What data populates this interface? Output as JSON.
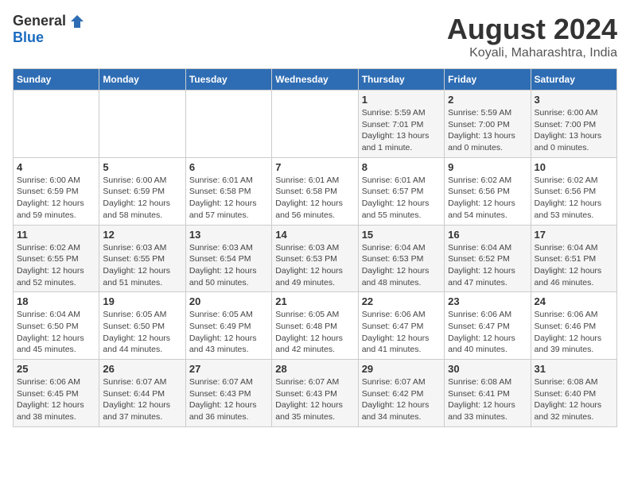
{
  "header": {
    "logo_general": "General",
    "logo_blue": "Blue",
    "title": "August 2024",
    "subtitle": "Koyali, Maharashtra, India"
  },
  "days_of_week": [
    "Sunday",
    "Monday",
    "Tuesday",
    "Wednesday",
    "Thursday",
    "Friday",
    "Saturday"
  ],
  "weeks": [
    [
      {
        "day": "",
        "info": ""
      },
      {
        "day": "",
        "info": ""
      },
      {
        "day": "",
        "info": ""
      },
      {
        "day": "",
        "info": ""
      },
      {
        "day": "1",
        "info": "Sunrise: 5:59 AM\nSunset: 7:01 PM\nDaylight: 13 hours\nand 1 minute."
      },
      {
        "day": "2",
        "info": "Sunrise: 5:59 AM\nSunset: 7:00 PM\nDaylight: 13 hours\nand 0 minutes."
      },
      {
        "day": "3",
        "info": "Sunrise: 6:00 AM\nSunset: 7:00 PM\nDaylight: 13 hours\nand 0 minutes."
      }
    ],
    [
      {
        "day": "4",
        "info": "Sunrise: 6:00 AM\nSunset: 6:59 PM\nDaylight: 12 hours\nand 59 minutes."
      },
      {
        "day": "5",
        "info": "Sunrise: 6:00 AM\nSunset: 6:59 PM\nDaylight: 12 hours\nand 58 minutes."
      },
      {
        "day": "6",
        "info": "Sunrise: 6:01 AM\nSunset: 6:58 PM\nDaylight: 12 hours\nand 57 minutes."
      },
      {
        "day": "7",
        "info": "Sunrise: 6:01 AM\nSunset: 6:58 PM\nDaylight: 12 hours\nand 56 minutes."
      },
      {
        "day": "8",
        "info": "Sunrise: 6:01 AM\nSunset: 6:57 PM\nDaylight: 12 hours\nand 55 minutes."
      },
      {
        "day": "9",
        "info": "Sunrise: 6:02 AM\nSunset: 6:56 PM\nDaylight: 12 hours\nand 54 minutes."
      },
      {
        "day": "10",
        "info": "Sunrise: 6:02 AM\nSunset: 6:56 PM\nDaylight: 12 hours\nand 53 minutes."
      }
    ],
    [
      {
        "day": "11",
        "info": "Sunrise: 6:02 AM\nSunset: 6:55 PM\nDaylight: 12 hours\nand 52 minutes."
      },
      {
        "day": "12",
        "info": "Sunrise: 6:03 AM\nSunset: 6:55 PM\nDaylight: 12 hours\nand 51 minutes."
      },
      {
        "day": "13",
        "info": "Sunrise: 6:03 AM\nSunset: 6:54 PM\nDaylight: 12 hours\nand 50 minutes."
      },
      {
        "day": "14",
        "info": "Sunrise: 6:03 AM\nSunset: 6:53 PM\nDaylight: 12 hours\nand 49 minutes."
      },
      {
        "day": "15",
        "info": "Sunrise: 6:04 AM\nSunset: 6:53 PM\nDaylight: 12 hours\nand 48 minutes."
      },
      {
        "day": "16",
        "info": "Sunrise: 6:04 AM\nSunset: 6:52 PM\nDaylight: 12 hours\nand 47 minutes."
      },
      {
        "day": "17",
        "info": "Sunrise: 6:04 AM\nSunset: 6:51 PM\nDaylight: 12 hours\nand 46 minutes."
      }
    ],
    [
      {
        "day": "18",
        "info": "Sunrise: 6:04 AM\nSunset: 6:50 PM\nDaylight: 12 hours\nand 45 minutes."
      },
      {
        "day": "19",
        "info": "Sunrise: 6:05 AM\nSunset: 6:50 PM\nDaylight: 12 hours\nand 44 minutes."
      },
      {
        "day": "20",
        "info": "Sunrise: 6:05 AM\nSunset: 6:49 PM\nDaylight: 12 hours\nand 43 minutes."
      },
      {
        "day": "21",
        "info": "Sunrise: 6:05 AM\nSunset: 6:48 PM\nDaylight: 12 hours\nand 42 minutes."
      },
      {
        "day": "22",
        "info": "Sunrise: 6:06 AM\nSunset: 6:47 PM\nDaylight: 12 hours\nand 41 minutes."
      },
      {
        "day": "23",
        "info": "Sunrise: 6:06 AM\nSunset: 6:47 PM\nDaylight: 12 hours\nand 40 minutes."
      },
      {
        "day": "24",
        "info": "Sunrise: 6:06 AM\nSunset: 6:46 PM\nDaylight: 12 hours\nand 39 minutes."
      }
    ],
    [
      {
        "day": "25",
        "info": "Sunrise: 6:06 AM\nSunset: 6:45 PM\nDaylight: 12 hours\nand 38 minutes."
      },
      {
        "day": "26",
        "info": "Sunrise: 6:07 AM\nSunset: 6:44 PM\nDaylight: 12 hours\nand 37 minutes."
      },
      {
        "day": "27",
        "info": "Sunrise: 6:07 AM\nSunset: 6:43 PM\nDaylight: 12 hours\nand 36 minutes."
      },
      {
        "day": "28",
        "info": "Sunrise: 6:07 AM\nSunset: 6:43 PM\nDaylight: 12 hours\nand 35 minutes."
      },
      {
        "day": "29",
        "info": "Sunrise: 6:07 AM\nSunset: 6:42 PM\nDaylight: 12 hours\nand 34 minutes."
      },
      {
        "day": "30",
        "info": "Sunrise: 6:08 AM\nSunset: 6:41 PM\nDaylight: 12 hours\nand 33 minutes."
      },
      {
        "day": "31",
        "info": "Sunrise: 6:08 AM\nSunset: 6:40 PM\nDaylight: 12 hours\nand 32 minutes."
      }
    ]
  ]
}
